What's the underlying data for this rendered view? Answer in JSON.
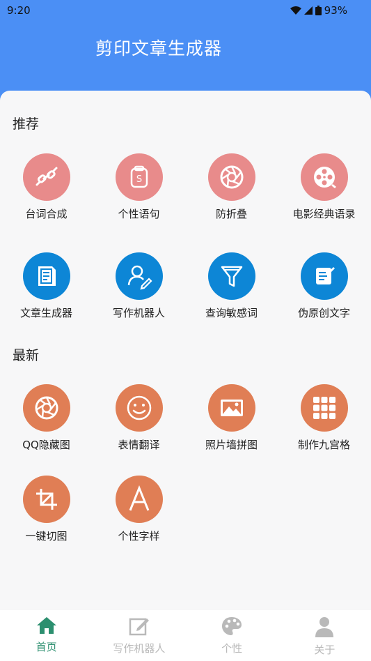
{
  "status": {
    "time": "9:20",
    "battery": "93%"
  },
  "header": {
    "title": "剪印文章生成器"
  },
  "sections": {
    "recommend": {
      "title": "推荐",
      "items": [
        {
          "label": "台词合成",
          "icon": "link-icon"
        },
        {
          "label": "个性语句",
          "icon": "s-bag-icon"
        },
        {
          "label": "防折叠",
          "icon": "aperture-icon"
        },
        {
          "label": "电影经典语录",
          "icon": "film-reel-icon"
        },
        {
          "label": "文章生成器",
          "icon": "document-icon"
        },
        {
          "label": "写作机器人",
          "icon": "user-edit-icon"
        },
        {
          "label": "查询敏感词",
          "icon": "filter-icon"
        },
        {
          "label": "伪原创文字",
          "icon": "note-edit-icon"
        }
      ]
    },
    "latest": {
      "title": "最新",
      "items": [
        {
          "label": "QQ隐藏图",
          "icon": "aperture-icon"
        },
        {
          "label": "表情翻译",
          "icon": "smiley-icon"
        },
        {
          "label": "照片墙拼图",
          "icon": "image-icon"
        },
        {
          "label": "制作九宫格",
          "icon": "grid-icon"
        },
        {
          "label": "一键切图",
          "icon": "crop-icon"
        },
        {
          "label": "个性字样",
          "icon": "letter-a-icon"
        }
      ]
    }
  },
  "nav": [
    {
      "label": "首页",
      "icon": "home-icon",
      "active": true
    },
    {
      "label": "写作机器人",
      "icon": "edit-icon",
      "active": false
    },
    {
      "label": "个性",
      "icon": "palette-icon",
      "active": false
    },
    {
      "label": "关于",
      "icon": "person-icon",
      "active": false
    }
  ],
  "colors": {
    "header": "#4b8ff5",
    "pink": "#e88b8b",
    "blue": "#0d86d6",
    "orange": "#e07e55",
    "nav_active": "#2c8f6f"
  }
}
